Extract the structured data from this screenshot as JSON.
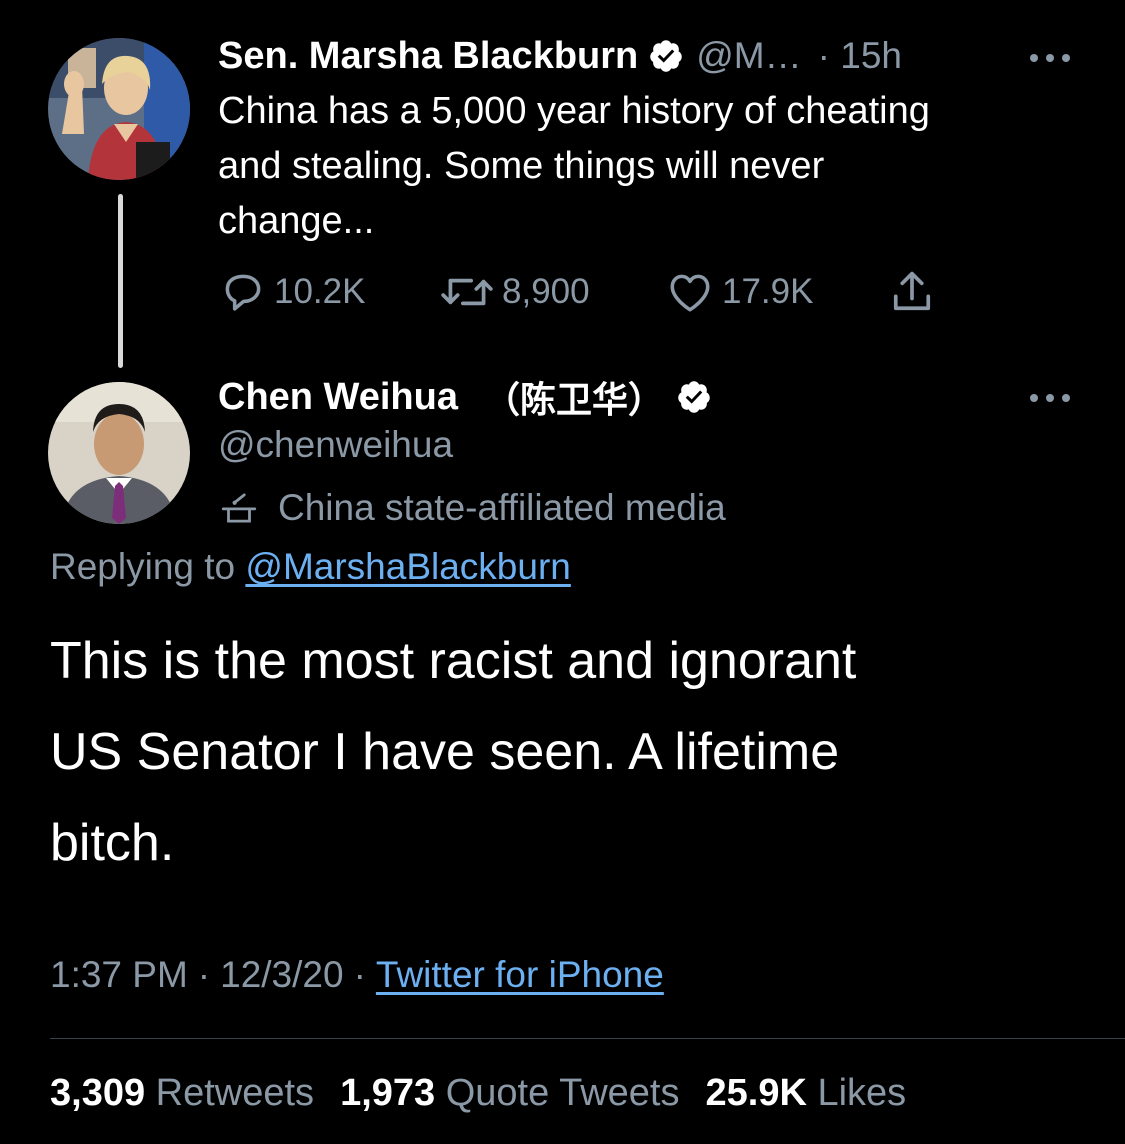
{
  "parent_tweet": {
    "display_name": "Sen. Marsha Blackburn",
    "handle": "@M…",
    "time": "· 15h",
    "text": "China has a 5,000 year history of cheating\nand stealing. Some things will never\nchange...",
    "replies": "10.2K",
    "retweets": "8,900",
    "likes": "17.9K",
    "icons": [
      "verified-badge-icon",
      "more-icon",
      "reply-icon",
      "retweet-icon",
      "like-icon",
      "share-icon"
    ]
  },
  "main_tweet": {
    "display_name": "Chen Weihua",
    "display_name_cjk": "（陈卫华）",
    "handle": "@chenweihua",
    "affiliation": "China state-affiliated media",
    "replying_prefix": "Replying to",
    "replying_handle": "@MarshaBlackburn",
    "text": "This is the most racist and ignorant\nUS Senator I have seen.  A lifetime\nbitch.",
    "time": "1:37 PM",
    "date": "12/3/20",
    "separator": "·",
    "source": "Twitter for iPhone",
    "icons": [
      "verified-badge-icon",
      "more-icon",
      "state-media-podium-icon"
    ]
  },
  "stats": {
    "retweets_count": "3,309",
    "retweets_label": "Retweets",
    "quotes_count": "1,973",
    "quotes_label": "Quote Tweets",
    "likes_count": "25.9K",
    "likes_label": "Likes"
  },
  "colors": {
    "background": "#000000",
    "text": "#ffffff",
    "muted": "#8b98a5",
    "link": "#6cb0f2",
    "divider": "#38444d"
  }
}
